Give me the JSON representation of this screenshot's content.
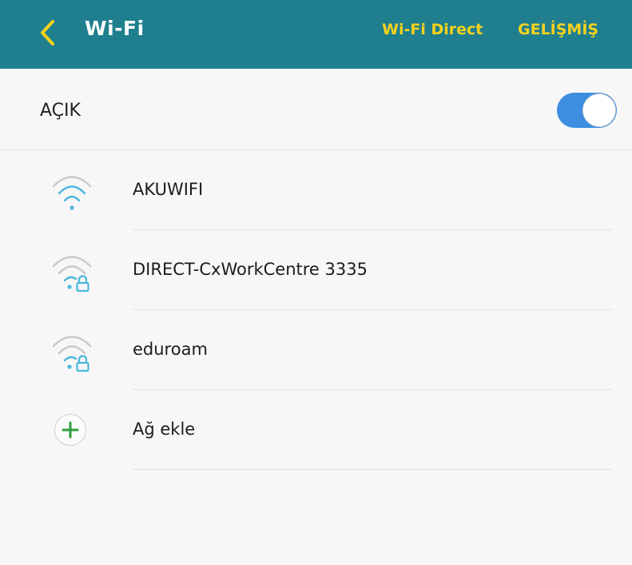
{
  "appbar": {
    "title": "Wi-Fi",
    "action_direct": "Wi-Fi Direct",
    "action_advanced": "GELİŞMİŞ",
    "background_color": "#1f7f8f",
    "action_color": "#f5d21c"
  },
  "wifi_toggle": {
    "label": "AÇIK",
    "state": "on",
    "accent_color": "#3d8ee0"
  },
  "networks": [
    {
      "name": "AKUWIFI",
      "secured": false,
      "icon": "wifi-icon"
    },
    {
      "name": "DIRECT-CxWorkCentre 3335",
      "secured": true,
      "icon": "wifi-lock-icon"
    },
    {
      "name": "eduroam",
      "secured": true,
      "icon": "wifi-lock-icon"
    }
  ],
  "add_network": {
    "label": "Ağ ekle",
    "icon": "plus-icon",
    "icon_color": "#2f9e3f"
  }
}
